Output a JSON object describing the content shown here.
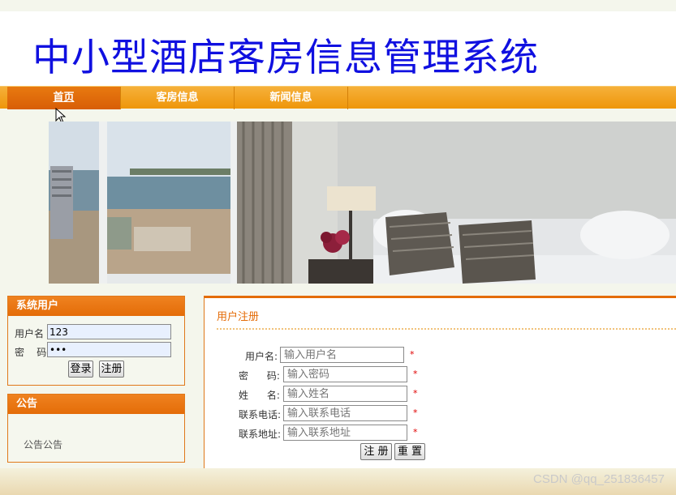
{
  "site": {
    "title": "中小型酒店客房信息管理系统"
  },
  "nav": {
    "items": [
      "首页",
      "客房信息",
      "新闻信息"
    ]
  },
  "login": {
    "header": "系统用户",
    "username_label": "用户名",
    "password_label": "密    码",
    "username_value": "123",
    "password_value": "•••",
    "login_button": "登录",
    "register_button": "注册"
  },
  "notice": {
    "header": "公告",
    "text": "公告公告"
  },
  "register": {
    "title": "用户注册",
    "fields": [
      {
        "label": "用户名:",
        "placeholder": "输入用户名"
      },
      {
        "label": "密      码:",
        "placeholder": "输入密码"
      },
      {
        "label": "姓      名:",
        "placeholder": "输入姓名"
      },
      {
        "label": "联系电话:",
        "placeholder": "输入联系电话"
      },
      {
        "label": "联系地址:",
        "placeholder": "输入联系地址"
      }
    ],
    "required_mark": "*",
    "submit_button": "注 册",
    "reset_button": "重 置"
  },
  "watermark": "CSDN @qq_251836457",
  "colors": {
    "nav": "#ee960a",
    "accent": "#e46c08",
    "title": "#1010e0"
  }
}
